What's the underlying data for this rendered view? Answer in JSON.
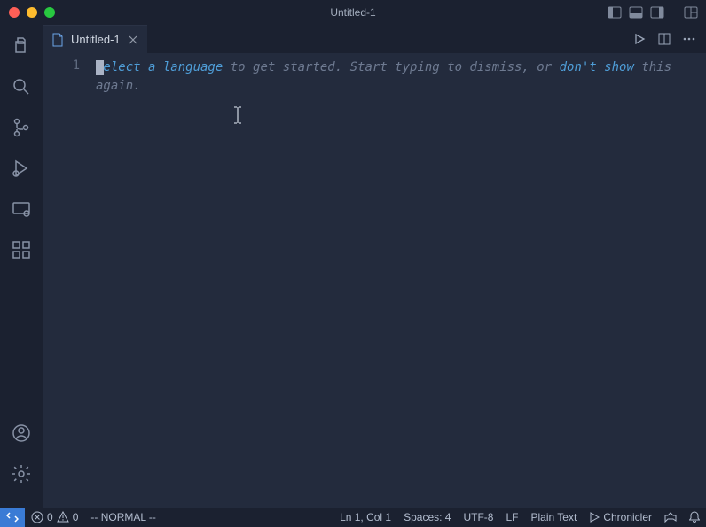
{
  "titlebar": {
    "title": "Untitled-1"
  },
  "tab": {
    "label": "Untitled-1"
  },
  "gutter": {
    "line1": "1"
  },
  "hint": {
    "link1": "Select a language",
    "mid": " to get started. Start typing to dismiss, or ",
    "link2": "don't show",
    "tail": " this again."
  },
  "status": {
    "errors": "0",
    "warnings": "0",
    "vim": "-- NORMAL --",
    "pos": "Ln 1, Col 1",
    "spaces": "Spaces: 4",
    "encoding": "UTF-8",
    "eol": "LF",
    "lang": "Plain Text",
    "chronicler": "Chronicler"
  }
}
